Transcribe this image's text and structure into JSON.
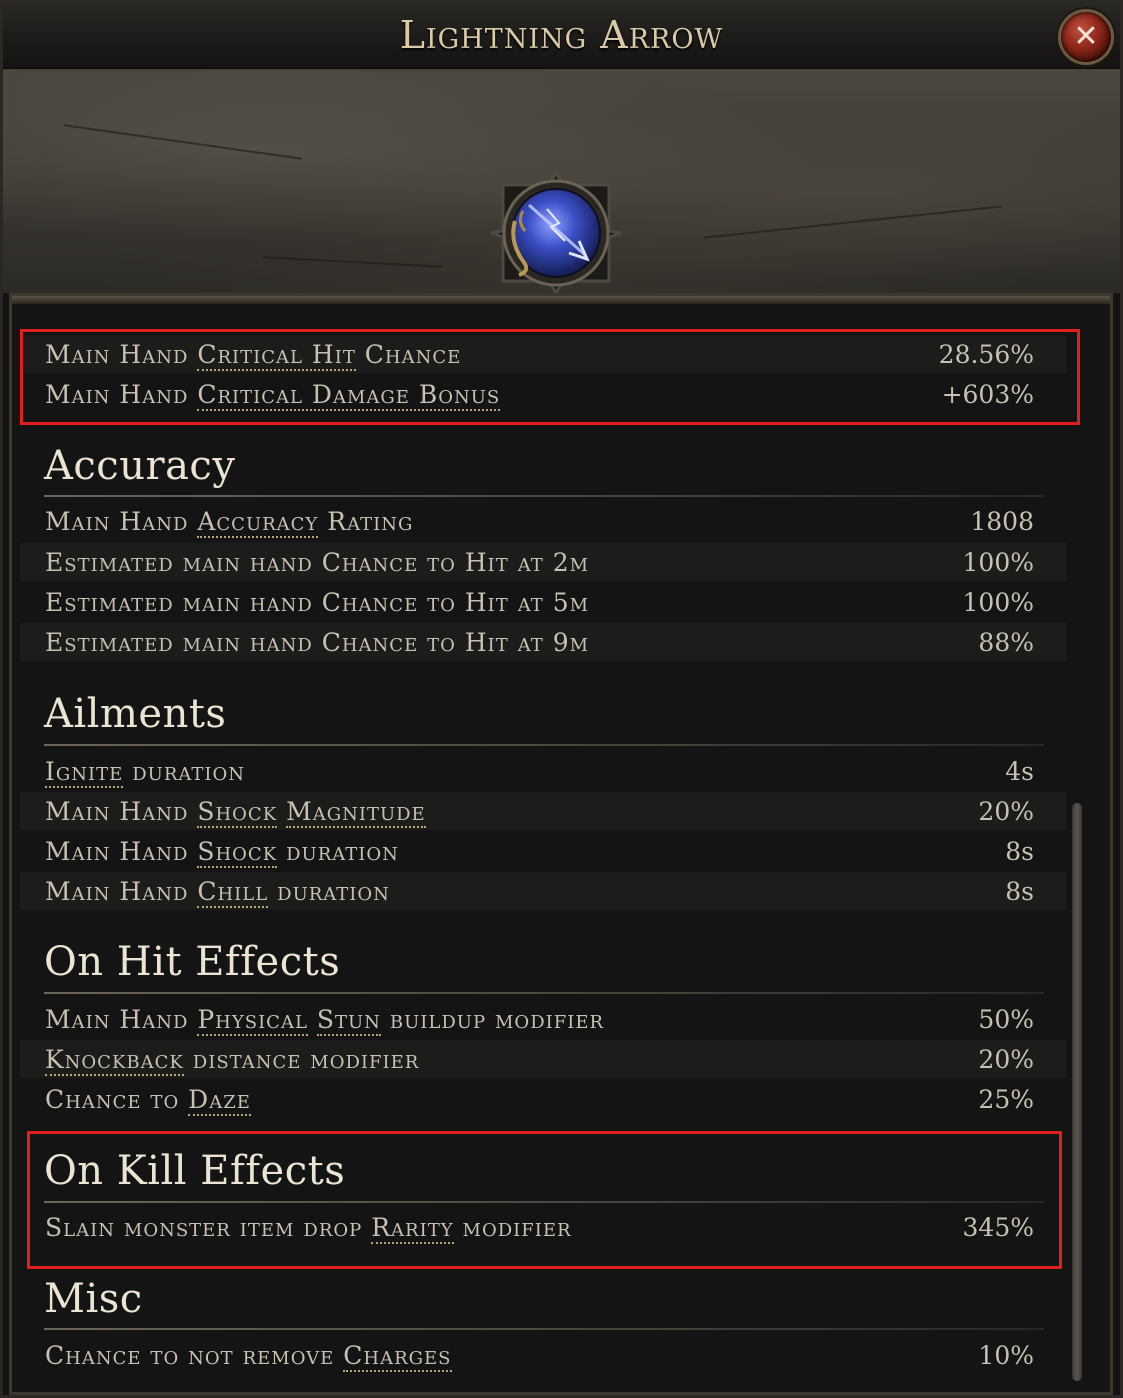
{
  "window": {
    "title": "Lightning Arrow",
    "close_label": "✕"
  },
  "gem": {
    "icon": "lightning-arrow-gem-icon",
    "color": "#3b4fc6"
  },
  "colors": {
    "highlight_box": "#e21e21",
    "text": "#c8c1b2",
    "heading": "#ebe4d3"
  },
  "sections": {
    "crit": {
      "rows": [
        {
          "pre": "Main Hand ",
          "kw": "Critical Hit",
          "post": " Chance",
          "value": "28.56%"
        },
        {
          "pre": "Main Hand ",
          "kw": "Critical Damage Bonus",
          "post": "",
          "value": "+603%"
        }
      ]
    },
    "accuracy": {
      "title": "Accuracy",
      "rows": [
        {
          "pre": "Main Hand ",
          "kw": "Accuracy",
          "post": " Rating",
          "value": "1808"
        },
        {
          "pre": "Estimated main hand Chance to Hit at 2m",
          "kw": "",
          "post": "",
          "value": "100%"
        },
        {
          "pre": "Estimated main hand Chance to Hit at 5m",
          "kw": "",
          "post": "",
          "value": "100%"
        },
        {
          "pre": "Estimated main hand Chance to Hit at 9m",
          "kw": "",
          "post": "",
          "value": "88%"
        }
      ]
    },
    "ailments": {
      "title": "Ailments",
      "rows": [
        {
          "pre": "",
          "kw": "Ignite",
          "post": " duration",
          "value": "4s"
        },
        {
          "pre": "Main Hand ",
          "kw": "Shock",
          "kw2": "Magnitude",
          "post": "",
          "value": "20%"
        },
        {
          "pre": "Main Hand ",
          "kw": "Shock",
          "post": " duration",
          "value": "8s"
        },
        {
          "pre": "Main Hand ",
          "kw": "Chill",
          "post": " duration",
          "value": "8s"
        }
      ]
    },
    "on_hit": {
      "title": "On Hit Effects",
      "rows": [
        {
          "pre": "Main Hand ",
          "kw": "Physical",
          "kw2": "Stun",
          "post": " buildup modifier",
          "value": "50%"
        },
        {
          "pre": "",
          "kw": "Knockback",
          "post": " distance modifier",
          "value": "20%"
        },
        {
          "pre": "Chance to ",
          "kw": "Daze",
          "post": "",
          "value": "25%"
        }
      ]
    },
    "on_kill": {
      "title": "On Kill Effects",
      "rows": [
        {
          "pre": "Slain monster item drop ",
          "kw": "Rarity",
          "post": " modifier",
          "value": "345%"
        }
      ]
    },
    "misc": {
      "title": "Misc",
      "rows": [
        {
          "pre": "Chance to not remove ",
          "kw": "Charges",
          "post": "",
          "value": "10%"
        }
      ]
    }
  }
}
